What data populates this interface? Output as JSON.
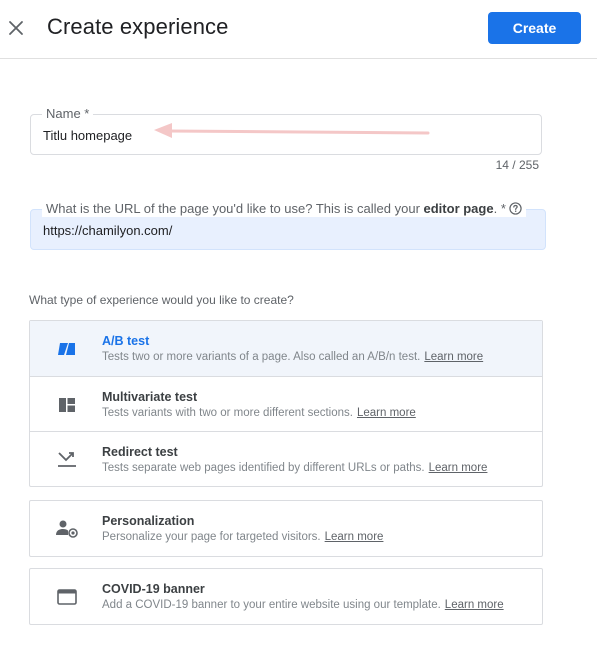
{
  "header": {
    "title": "Create experience",
    "create_label": "Create"
  },
  "name_field": {
    "label": "Name *",
    "value": "Titlu homepage",
    "counter": "14 / 255"
  },
  "url_field": {
    "label_prefix": "What is the URL of the page you'd like to use? This is called your ",
    "label_bold": "editor page",
    "label_suffix": ". *",
    "value": "https://chamilyon.com/"
  },
  "question": "What type of experience would you like to create?",
  "options": [
    {
      "title": "A/B test",
      "description": "Tests two or more variants of a page. Also called an A/B/n test.",
      "learn_more": "Learn more",
      "icon": "ab-test-icon",
      "selected": true
    },
    {
      "title": "Multivariate test",
      "description": "Tests variants with two or more different sections.",
      "learn_more": "Learn more",
      "icon": "multivariate-icon",
      "selected": false
    },
    {
      "title": "Redirect test",
      "description": "Tests separate web pages identified by different URLs or paths.",
      "learn_more": "Learn more",
      "icon": "redirect-icon",
      "selected": false
    },
    {
      "title": "Personalization",
      "description": "Personalize your page for targeted visitors.",
      "learn_more": "Learn more",
      "icon": "personalization-icon",
      "selected": false
    },
    {
      "title": "COVID-19 banner",
      "description": "Add a COVID-19 banner to your entire website using our template.",
      "learn_more": "Learn more",
      "icon": "banner-icon",
      "selected": false
    }
  ],
  "colors": {
    "accent": "#1a73e8",
    "annotation_arrow": "#f4c7c7"
  }
}
